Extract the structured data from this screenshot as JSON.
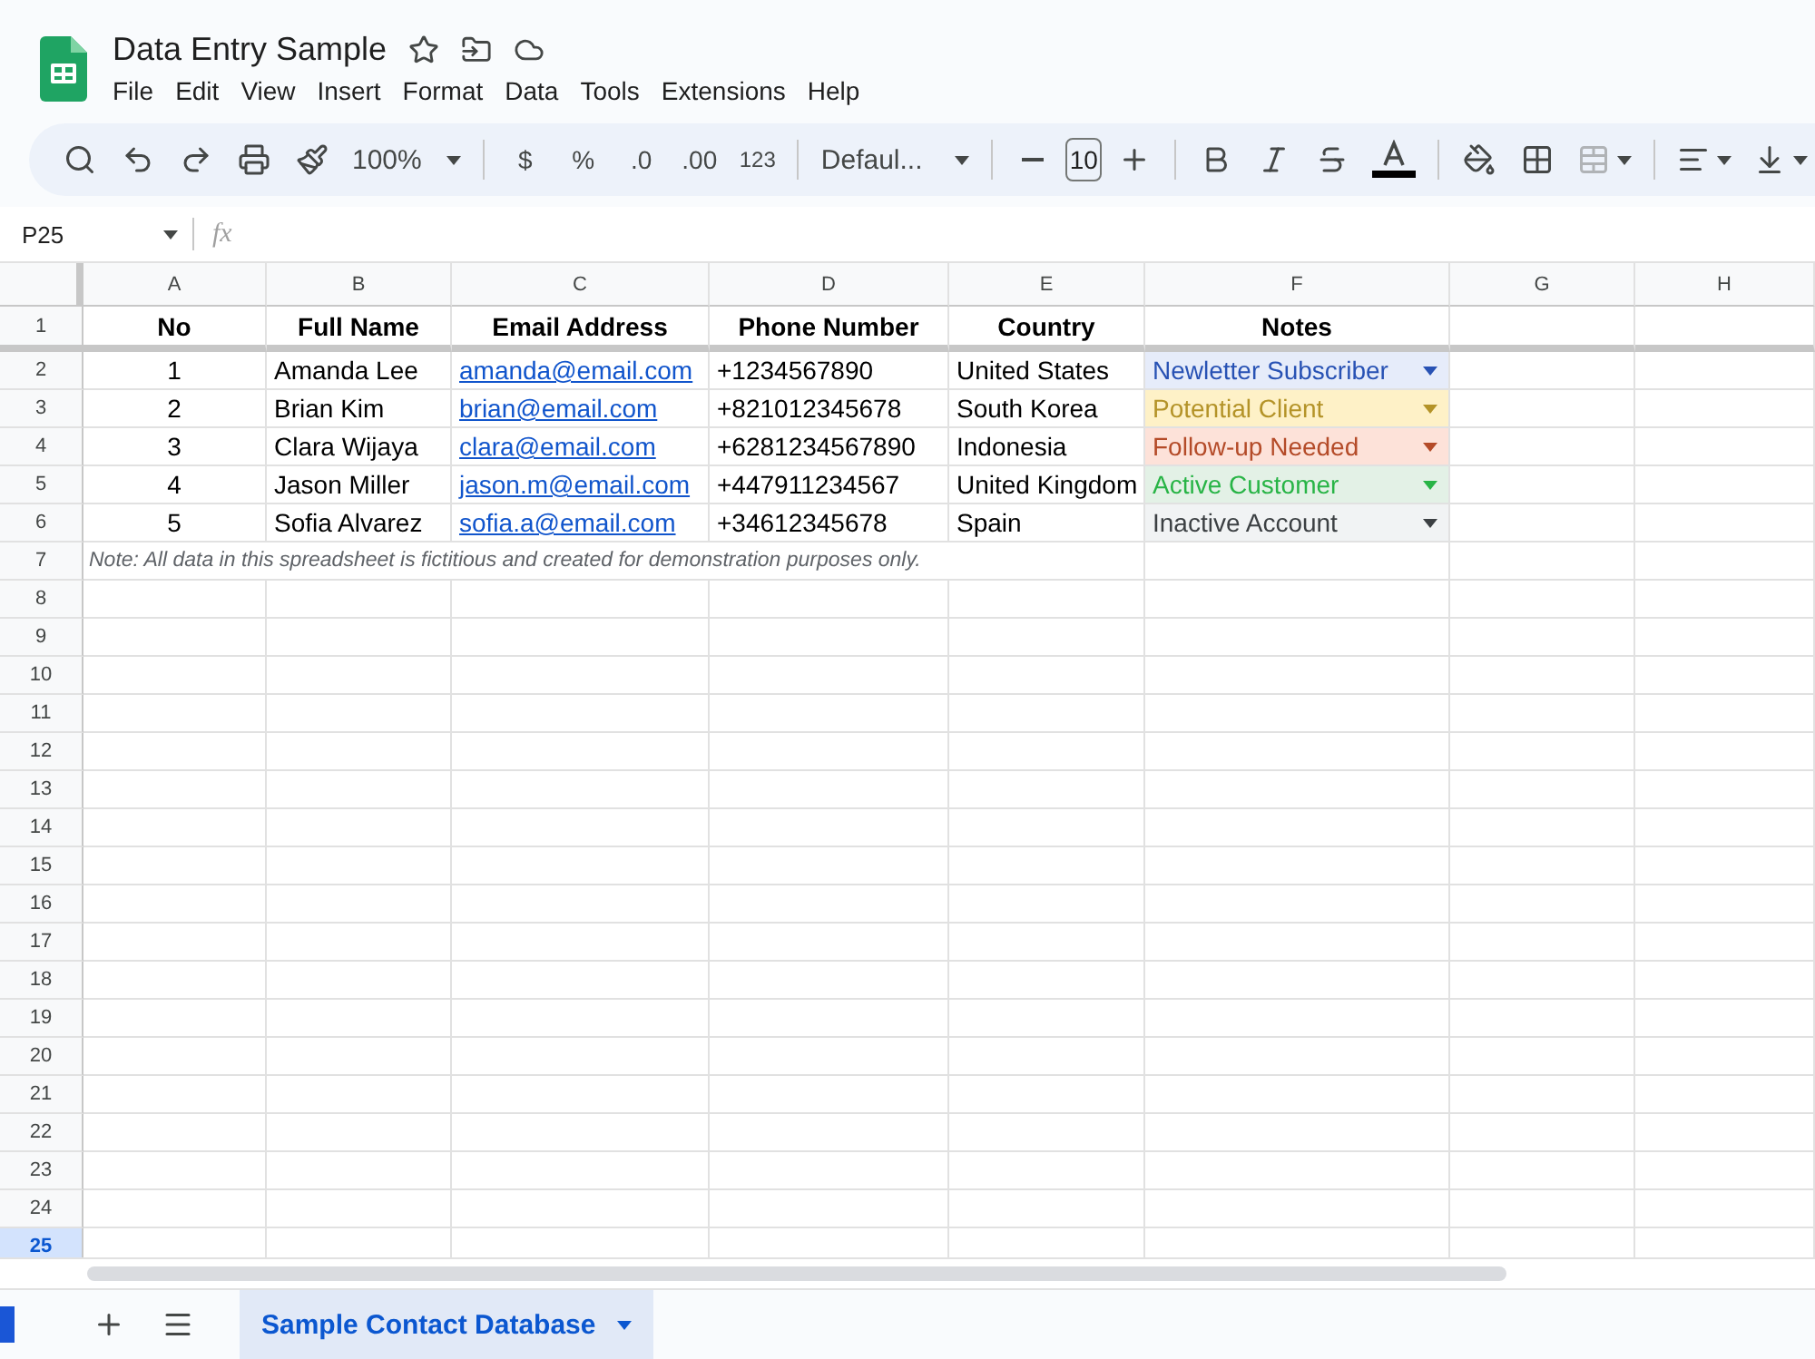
{
  "document": {
    "title": "Data Entry Sample"
  },
  "menu": [
    "File",
    "Edit",
    "View",
    "Insert",
    "Format",
    "Data",
    "Tools",
    "Extensions",
    "Help"
  ],
  "toolbar": {
    "zoom": "100%",
    "currency": "$",
    "percent": "%",
    "decrease_decimals": ".0",
    "increase_decimals": ".00",
    "number_format": "123",
    "font": "Defaul...",
    "font_size": "10"
  },
  "formula_bar": {
    "cell_ref": "P25",
    "fx": "fx"
  },
  "grid": {
    "columns": [
      "A",
      "B",
      "C",
      "D",
      "E",
      "F",
      "G",
      "H"
    ],
    "header_row": {
      "number": "1",
      "selected": false,
      "cells": [
        "No",
        "Full Name",
        "Email Address",
        "Phone Number",
        "Country",
        "Notes"
      ]
    },
    "rows": [
      {
        "number": "2",
        "selected": false,
        "no": "1",
        "name": "Amanda Lee",
        "email": "amanda@email.com",
        "phone": "+1234567890",
        "country": "United States",
        "note": {
          "text": "Newletter Subscriber",
          "color": "#e6ecfa"
        }
      },
      {
        "number": "3",
        "selected": false,
        "no": "2",
        "name": "Brian Kim",
        "email": "brian@email.com",
        "phone": "+821012345678",
        "country": "South Korea",
        "note": {
          "text": "Potential Client",
          "color": "#fef1c7"
        }
      },
      {
        "number": "4",
        "selected": false,
        "no": "3",
        "name": "Clara Wijaya",
        "email": "clara@email.com",
        "phone": "+6281234567890",
        "country": "Indonesia",
        "note": {
          "text": "Follow-up Needed",
          "color": "#fde2d9"
        }
      },
      {
        "number": "5",
        "selected": false,
        "no": "4",
        "name": "Jason Miller",
        "email": "jason.m@email.com",
        "phone": "+447911234567",
        "country": "United Kingdom",
        "note": {
          "text": "Active Customer",
          "color": "#e3f1e6"
        }
      },
      {
        "number": "6",
        "selected": false,
        "no": "5",
        "name": "Sofia Alvarez",
        "email": "sofia.a@email.com",
        "phone": "+34612345678",
        "country": "Spain",
        "note": {
          "text": "Inactive Account",
          "color": "#f1f3f4"
        }
      }
    ],
    "note_row": {
      "number": "7",
      "selected": false,
      "text": "Note: All data in this spreadsheet is fictitious and created for demonstration purposes only."
    },
    "empty_rows": [
      {
        "number": "8",
        "selected": false
      },
      {
        "number": "9",
        "selected": false
      },
      {
        "number": "10",
        "selected": false
      },
      {
        "number": "11",
        "selected": false
      },
      {
        "number": "12",
        "selected": false
      },
      {
        "number": "13",
        "selected": false
      },
      {
        "number": "14",
        "selected": false
      },
      {
        "number": "15",
        "selected": false
      },
      {
        "number": "16",
        "selected": false
      },
      {
        "number": "17",
        "selected": false
      },
      {
        "number": "18",
        "selected": false
      },
      {
        "number": "19",
        "selected": false
      },
      {
        "number": "20",
        "selected": false
      },
      {
        "number": "21",
        "selected": false
      },
      {
        "number": "22",
        "selected": false
      },
      {
        "number": "23",
        "selected": false
      },
      {
        "number": "24",
        "selected": false
      },
      {
        "number": "25",
        "selected": true
      }
    ]
  },
  "sheet_tabs": [
    {
      "label": "Sample Contact Database",
      "selected": true
    }
  ]
}
